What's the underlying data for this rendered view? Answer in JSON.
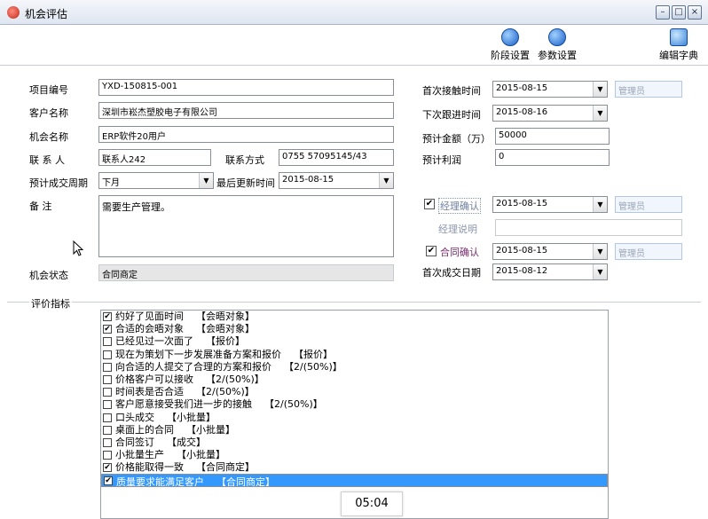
{
  "window": {
    "title": "机会评估"
  },
  "toolbar": {
    "stage_settings": "阶段设置",
    "param_settings": "参数设置",
    "edit_dictionary": "编辑字典"
  },
  "form": {
    "project_no": {
      "label": "项目编号",
      "value": "YXD-150815-001"
    },
    "customer_name": {
      "label": "客户名称",
      "value": "深圳市崧杰塑胶电子有限公司"
    },
    "opportunity_name": {
      "label": "机会名称",
      "value": "ERP软件20用户"
    },
    "contact": {
      "label": "联 系 人",
      "value": "联系人242"
    },
    "contact_method": {
      "label": "联系方式",
      "value": "0755 57095145/43"
    },
    "expected_cycle": {
      "label": "预计成交周期",
      "value": "下月"
    },
    "last_update": {
      "label": "最后更新时间",
      "value": "2015-08-15"
    },
    "remarks": {
      "label": "备 注",
      "value": "需要生产管理。"
    },
    "status": {
      "label": "机会状态",
      "value": "合同商定"
    },
    "first_contact": {
      "label": "首次接触时间",
      "value": "2015-08-15",
      "user": "管理员"
    },
    "next_followup": {
      "label": "下次跟进时间",
      "value": "2015-08-16"
    },
    "expected_amount": {
      "label": "预计金额（万）",
      "value": "50000"
    },
    "expected_profit": {
      "label": "预计利润",
      "value": "0"
    },
    "manager_confirm": {
      "label": "经理确认",
      "checked": true,
      "date": "2015-08-15",
      "user": "管理员"
    },
    "manager_note": {
      "label": "经理说明",
      "value": ""
    },
    "contract_confirm": {
      "label": "合同确认",
      "checked": true,
      "date": "2015-08-15",
      "user": "管理员"
    },
    "first_deal_date": {
      "label": "首次成交日期",
      "value": "2015-08-12"
    }
  },
  "evaluation": {
    "title": "评价指标",
    "items": [
      {
        "text": "约好了见面时间",
        "tag": "【会晤对象】",
        "checked": true
      },
      {
        "text": "合适的会晤对象",
        "tag": "【会晤对象】",
        "checked": true
      },
      {
        "text": "已经见过一次面了",
        "tag": "【报价】",
        "checked": false
      },
      {
        "text": "现在为策划下一步发展准备方案和报价",
        "tag": "【报价】",
        "checked": false
      },
      {
        "text": "向合适的人提交了合理的方案和报价",
        "tag": "【2/(50%)】",
        "checked": false
      },
      {
        "text": "价格客户可以接收",
        "tag": "【2/(50%)】",
        "checked": false
      },
      {
        "text": "时间表是否合适",
        "tag": "【2/(50%)】",
        "checked": false
      },
      {
        "text": "客户愿意接受我们进一步的接触",
        "tag": "【2/(50%)】",
        "checked": false
      },
      {
        "text": "口头成交",
        "tag": "【小批量】",
        "checked": false
      },
      {
        "text": "桌面上的合同",
        "tag": "【小批量】",
        "checked": false
      },
      {
        "text": "合同签订",
        "tag": "【成交】",
        "checked": false
      },
      {
        "text": "小批量生产",
        "tag": "【小批量】",
        "checked": false
      },
      {
        "text": "价格能取得一致",
        "tag": "【合同商定】",
        "checked": true
      },
      {
        "text": "质量要求能满足客户",
        "tag": "【合同商定】",
        "checked": true,
        "selected": true
      }
    ]
  },
  "timer": "05:04"
}
